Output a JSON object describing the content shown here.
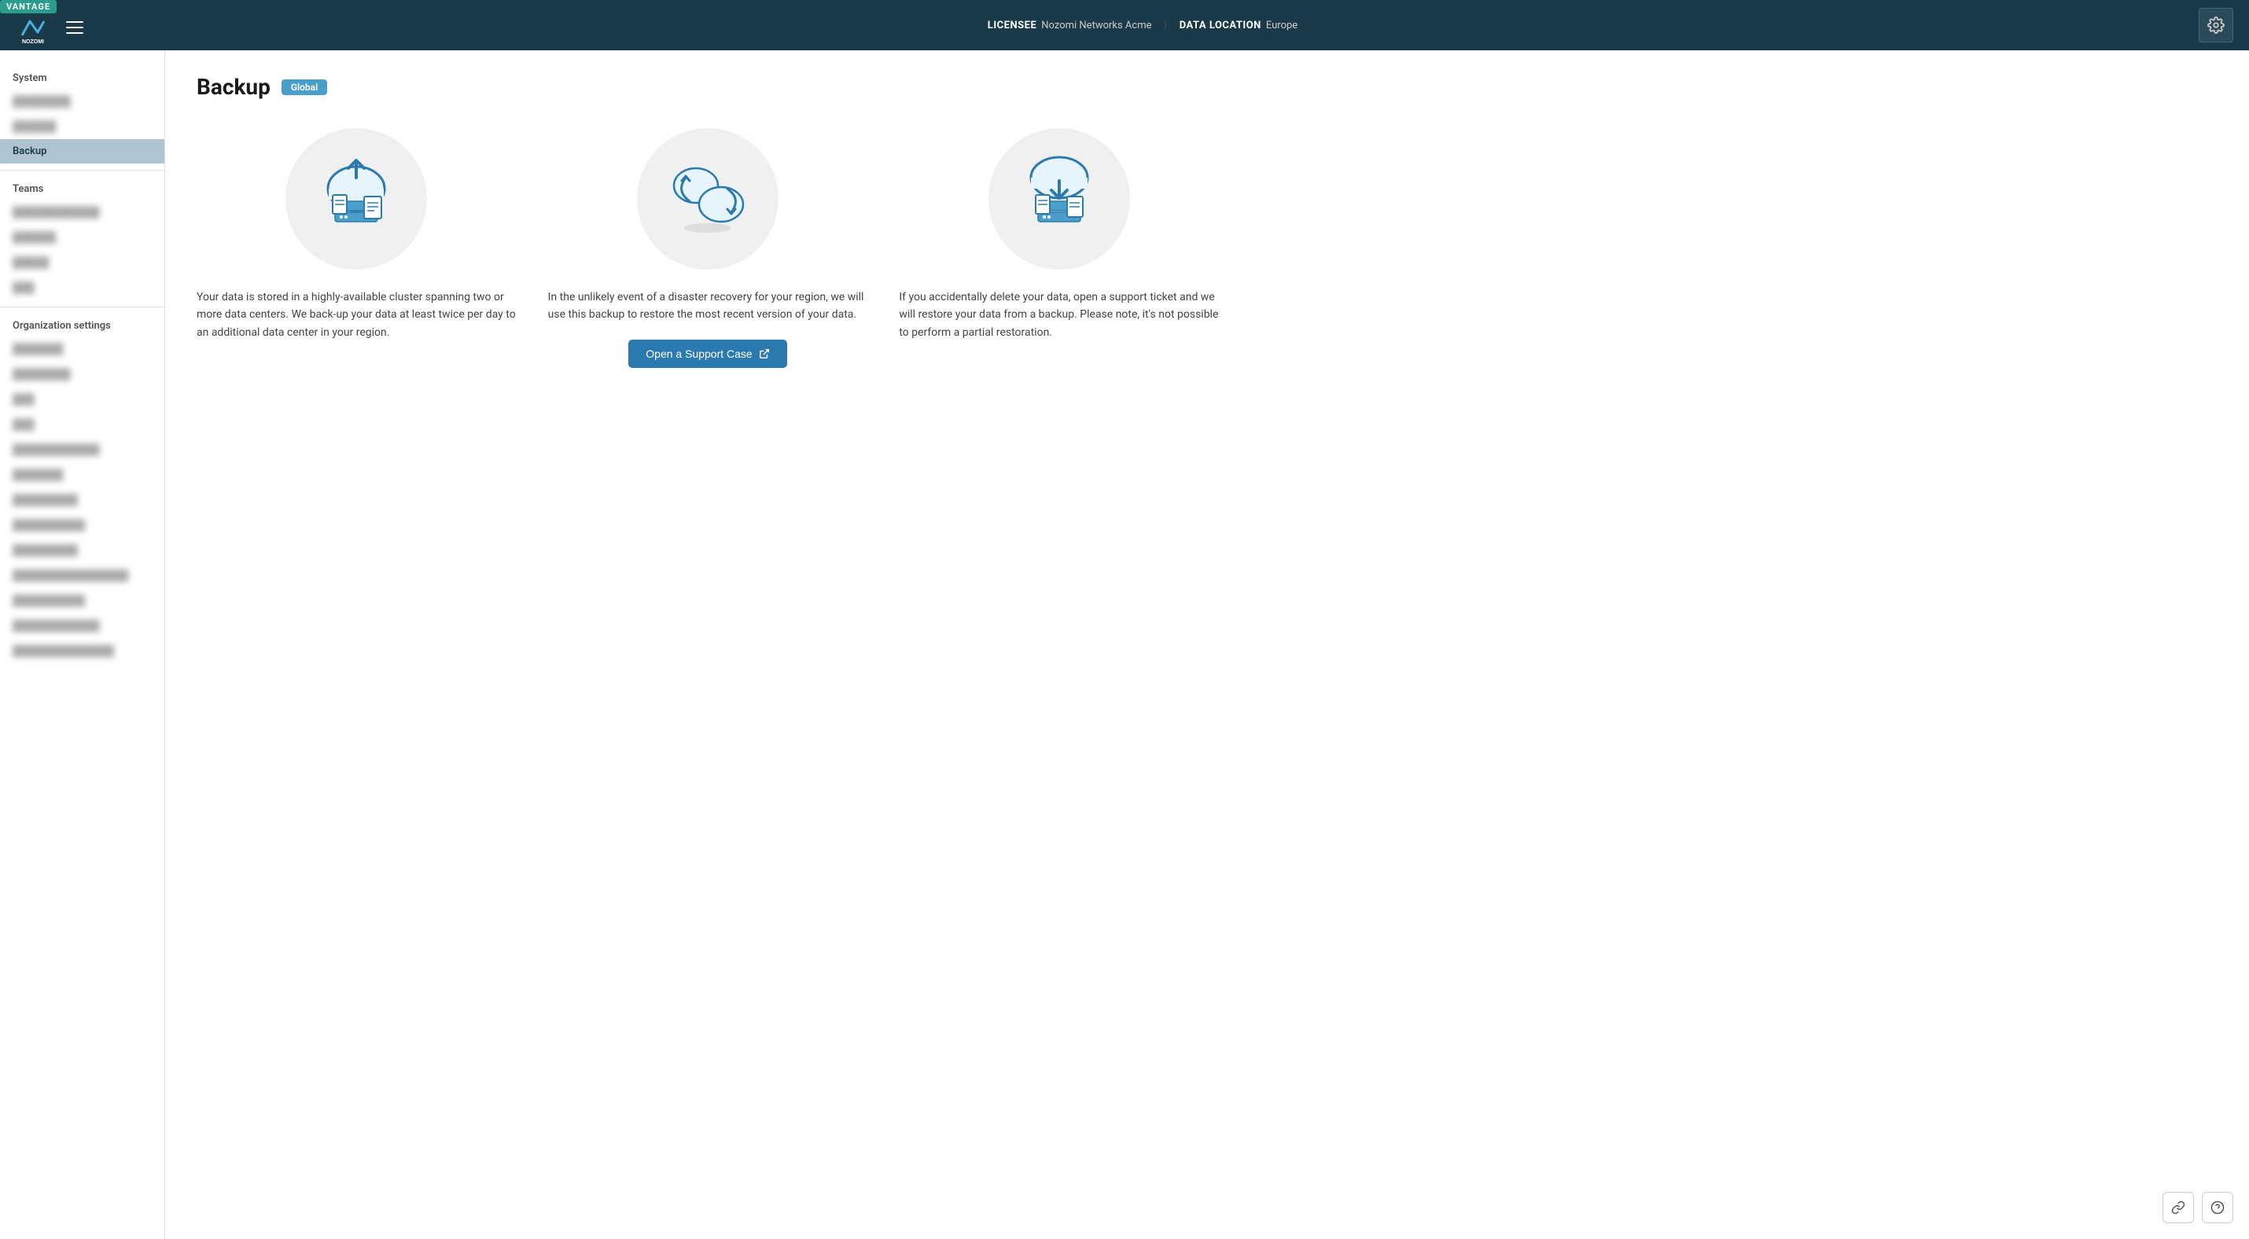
{
  "vantage": "VANTAGE",
  "header": {
    "licensee_label": "LICENSEE",
    "licensee_value": "Nozomi Networks Acme",
    "data_location_label": "DATA LOCATION",
    "data_location_value": "Europe"
  },
  "sidebar": {
    "system_label": "System",
    "system_items": [
      {
        "label": "blurred1",
        "blurred": true
      },
      {
        "label": "blurred2",
        "blurred": true
      },
      {
        "label": "Backup",
        "active": true
      }
    ],
    "teams_label": "Teams",
    "teams_items": [
      {
        "label": "blurred3",
        "blurred": true
      },
      {
        "label": "blurred4",
        "blurred": true
      },
      {
        "label": "blurred5",
        "blurred": true
      },
      {
        "label": "blurred6",
        "blurred": true
      }
    ],
    "org_settings_label": "Organization settings",
    "org_items": [
      {
        "label": "blurred7",
        "blurred": true
      },
      {
        "label": "blurred8",
        "blurred": true
      },
      {
        "label": "blurred9",
        "blurred": true
      },
      {
        "label": "blurred10",
        "blurred": true
      },
      {
        "label": "blurred11",
        "blurred": true
      },
      {
        "label": "blurred12",
        "blurred": true
      },
      {
        "label": "blurred13",
        "blurred": true
      },
      {
        "label": "blurred14",
        "blurred": true
      },
      {
        "label": "blurred15",
        "blurred": true
      },
      {
        "label": "blurred16",
        "blurred": true
      },
      {
        "label": "blurred17",
        "blurred": true
      },
      {
        "label": "blurred18",
        "blurred": true
      },
      {
        "label": "blurred19",
        "blurred": true
      },
      {
        "label": "blurred20",
        "blurred": true
      }
    ]
  },
  "page": {
    "title": "Backup",
    "badge": "Global"
  },
  "cards": [
    {
      "id": "backup-storage",
      "text": "Your data is stored in a highly-available cluster spanning two or more data centers. We back-up your data at least twice per day to an additional data center in your region.",
      "has_action": false
    },
    {
      "id": "disaster-recovery",
      "text": "In the unlikely event of a disaster recovery for your region, we will use this backup to restore the most recent version of your data.",
      "has_action": true,
      "action_label": "Open a Support Case"
    },
    {
      "id": "data-restore",
      "text": "If you accidentally delete your data, open a support ticket and we will restore your data from a backup. Please note, it's not possible to perform a partial restoration.",
      "has_action": false
    }
  ],
  "bottom_buttons": {
    "link_label": "link",
    "help_label": "help"
  }
}
